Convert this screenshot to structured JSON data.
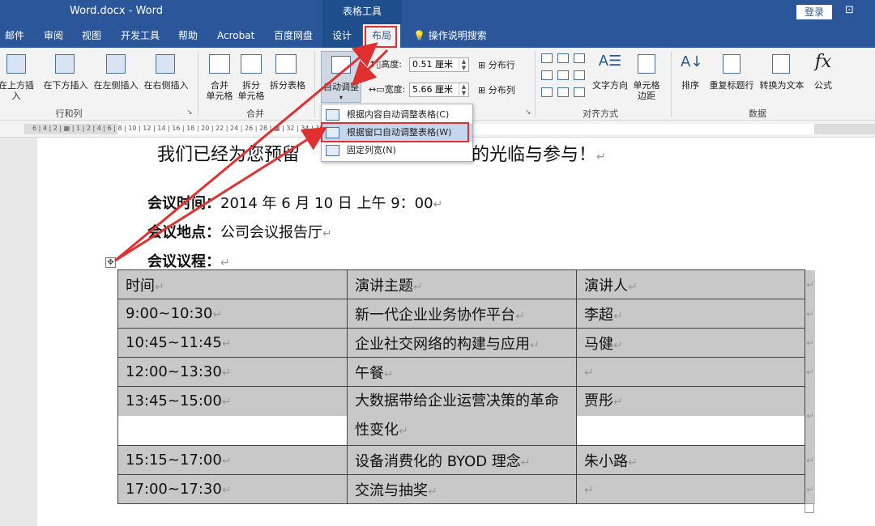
{
  "window": {
    "title": "Word.docx - Word",
    "context_tab_group": "表格工具",
    "login_label": "登录",
    "ribbon_display_icon": "ribbon-display-options-icon"
  },
  "tabs": [
    "邮件",
    "审阅",
    "视图",
    "开发工具",
    "帮助",
    "Acrobat",
    "百度网盘",
    "设计",
    "布局"
  ],
  "active_tab": "布局",
  "tell_me": "操作说明搜索",
  "ribbon": {
    "rows_cols": {
      "items": [
        "在上方插入",
        "在下方插入",
        "在左侧插入",
        "在右侧插入"
      ],
      "group_label": "行和列"
    },
    "merge": {
      "merge_cells_l1": "合并",
      "merge_cells_l2": "单元格",
      "split_cells_l1": "拆分",
      "split_cells_l2": "单元格",
      "split_table": "拆分表格",
      "group_label": "合并"
    },
    "cell_size": {
      "autofit_label": "自动调整",
      "height_label": "高度:",
      "height_value": "0.51 厘米",
      "width_label": "宽度:",
      "width_value": "5.66 厘米",
      "distribute_rows": "分布行",
      "distribute_cols": "分布列"
    },
    "alignment": {
      "text_direction": "文字方向",
      "cell_margins_l1": "单元格",
      "cell_margins_l2": "边距",
      "group_label": "对齐方式"
    },
    "data": {
      "sort": "排序",
      "repeat_header": "重复标题行",
      "convert_to_text": "转换为文本",
      "formula": "公式",
      "group_label": "数据"
    }
  },
  "ruler_text": "6 | 4 | 2 | ▦ | 1 | 2 | 4 | 6 | 8 | 10 | 12 | 14 | 16 | 18 | 20 | 22 | 24 | 26 | 28 | ▦ | 32 | 34 | 36 | 38 | 40 | 42 | 44 | ▦ 46 | 48 |",
  "autofit_menu": [
    {
      "label": "根据内容自动调整表格(C)"
    },
    {
      "label": "根据窗口自动调整表格(W)"
    },
    {
      "label": "固定列宽(N)"
    }
  ],
  "document": {
    "heading_partial": "我们已经为您预留",
    "heading_partial2": "待您的光临与参与！",
    "meeting_time_label": "会议时间：",
    "meeting_time_value": "2014 年 6 月 10 日  上午 9：00",
    "meeting_place_label": "会议地点：",
    "meeting_place_value": "公司会议报告厅",
    "agenda_label": "会议议程：",
    "table": {
      "header": [
        "时间",
        "演讲主题",
        "演讲人"
      ],
      "rows": [
        [
          "9:00~10:30",
          "新一代企业业务协作平台",
          "李超"
        ],
        [
          "10:45~11:45",
          "企业社交网络的构建与应用",
          "马健"
        ],
        [
          "12:00~13:30",
          "午餐",
          ""
        ],
        [
          "13:45~15:00",
          "大数据带给企业运营决策的革命性变化",
          "贾彤"
        ],
        [
          "15:15~17:00",
          "设备消费化的 BYOD 理念",
          "朱小路"
        ],
        [
          "17:00~17:30",
          "交流与抽奖",
          ""
        ]
      ],
      "row4_topic_line1": "大数据带给企业运营决策的革命",
      "row4_topic_line2": "性变化"
    },
    "para_mark": "↵"
  },
  "colors": {
    "brand_blue": "#2b579a",
    "highlight_red": "#e03030",
    "cell_gray": "#c8c8c8"
  }
}
